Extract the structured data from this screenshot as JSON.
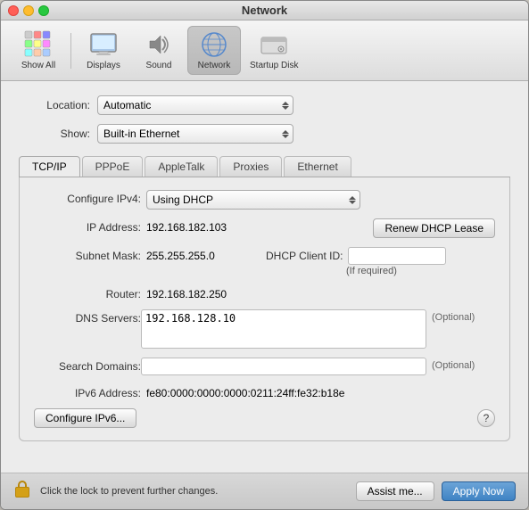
{
  "window": {
    "title": "Network"
  },
  "toolbar": {
    "show_all_label": "Show All",
    "displays_label": "Displays",
    "sound_label": "Sound",
    "network_label": "Network",
    "startup_disk_label": "Startup Disk"
  },
  "form": {
    "location_label": "Location:",
    "location_value": "Automatic",
    "show_label": "Show:",
    "show_value": "Built-in Ethernet"
  },
  "tabs": [
    {
      "id": "tcp",
      "label": "TCP/IP"
    },
    {
      "id": "pppoe",
      "label": "PPPoE"
    },
    {
      "id": "appletalk",
      "label": "AppleTalk"
    },
    {
      "id": "proxies",
      "label": "Proxies"
    },
    {
      "id": "ethernet",
      "label": "Ethernet"
    }
  ],
  "settings": {
    "configure_ipv4_label": "Configure IPv4:",
    "configure_ipv4_value": "Using DHCP",
    "ip_address_label": "IP Address:",
    "ip_address_value": "192.168.182.103",
    "renew_dhcp_label": "Renew DHCP Lease",
    "subnet_mask_label": "Subnet Mask:",
    "subnet_mask_value": "255.255.255.0",
    "dhcp_client_id_label": "DHCP Client ID:",
    "dhcp_client_id_placeholder": "",
    "dhcp_required_text": "(If required)",
    "router_label": "Router:",
    "router_value": "192.168.182.250",
    "dns_servers_label": "DNS Servers:",
    "dns_servers_value": "192.168.128.10",
    "dns_optional_text": "(Optional)",
    "search_domains_label": "Search Domains:",
    "search_domains_value": "",
    "search_optional_text": "(Optional)",
    "ipv6_address_label": "IPv6 Address:",
    "ipv6_address_value": "fe80:0000:0000:0000:0211:24ff:fe32:b18e",
    "configure_ipv6_label": "Configure IPv6..."
  },
  "bottom_bar": {
    "lock_text": "Click the lock to prevent further changes.",
    "assist_label": "Assist me...",
    "apply_label": "Apply Now"
  }
}
